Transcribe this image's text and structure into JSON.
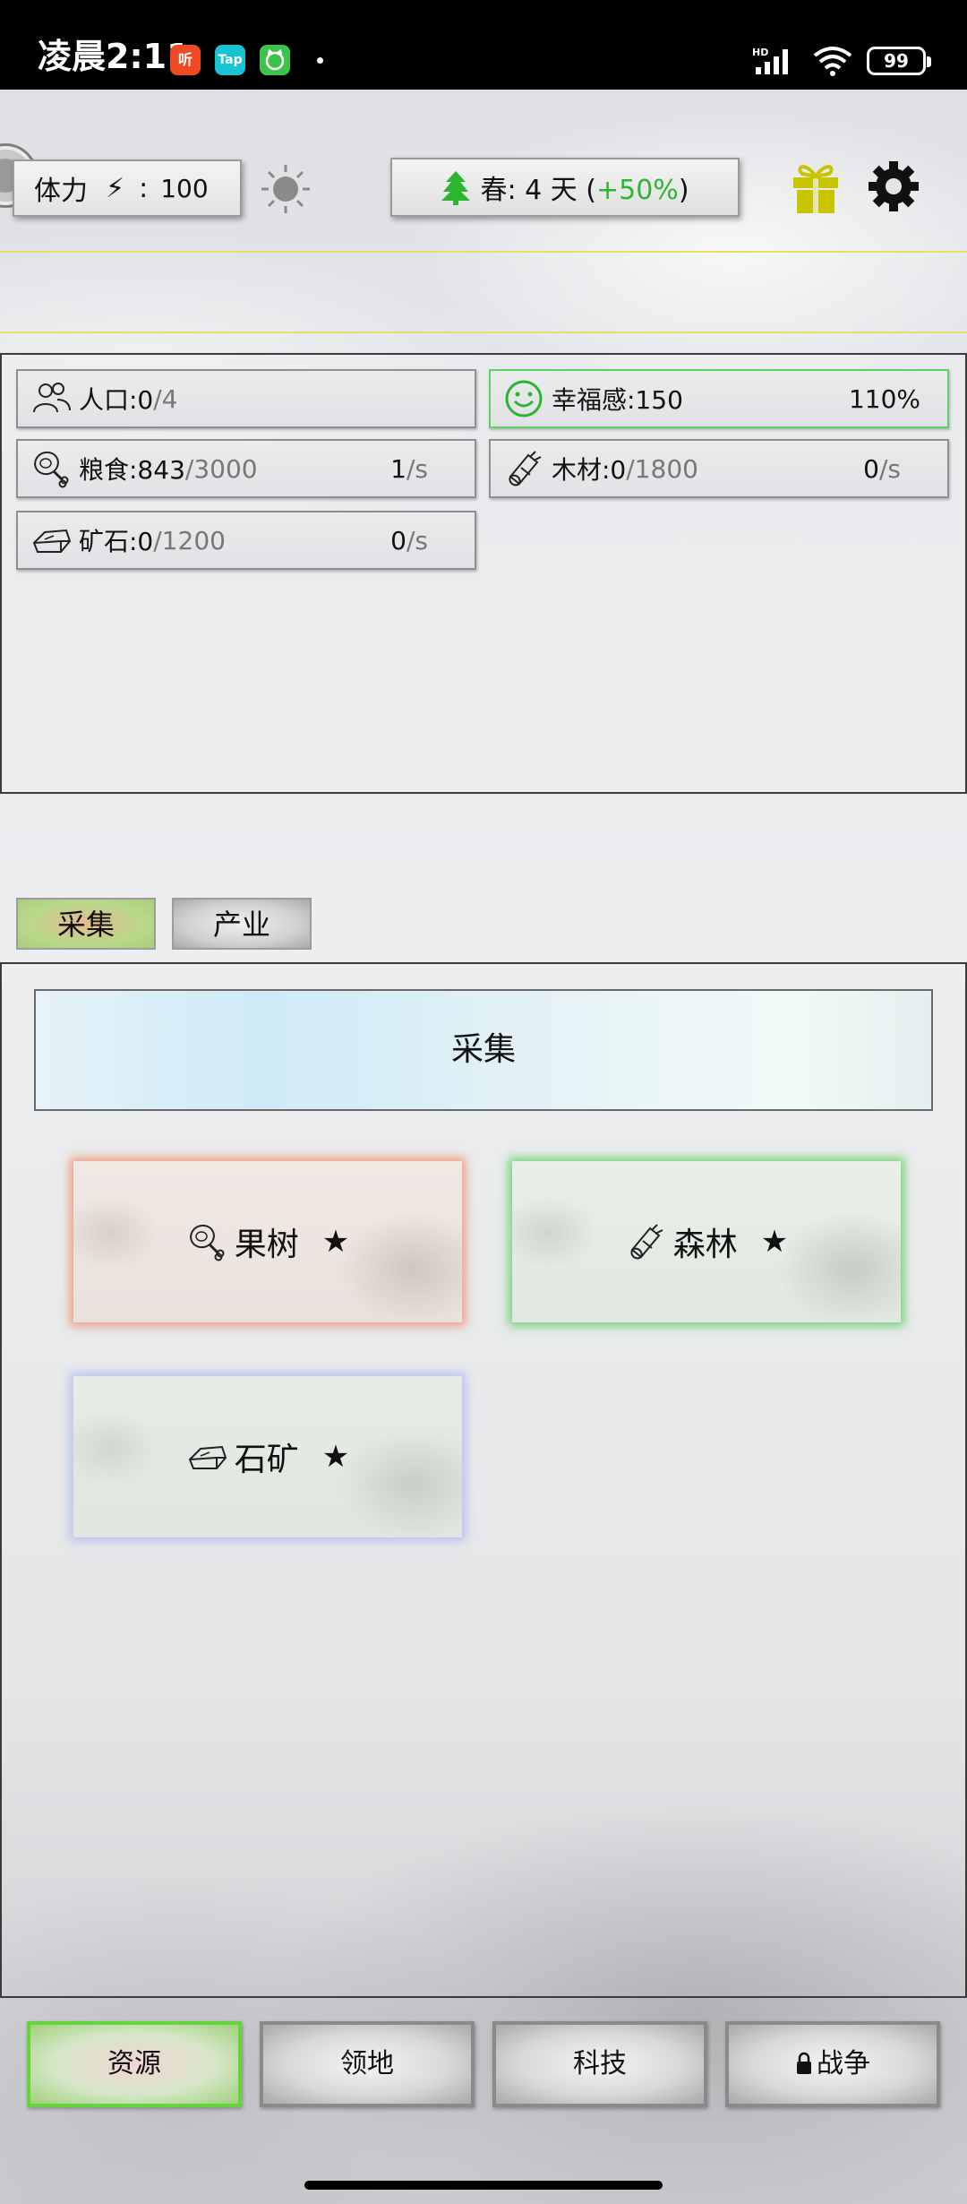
{
  "status_bar": {
    "time": "凌晨2:11",
    "apps": [
      {
        "name": "ting-app-icon",
        "text": "听",
        "color": "#f04a24"
      },
      {
        "name": "taptap-app-icon",
        "text": "Tap",
        "color": "#18c3d4"
      },
      {
        "name": "cat-app-icon",
        "text": "",
        "color": "#3ec34a"
      }
    ],
    "network": "HD",
    "battery": "99"
  },
  "top_bar": {
    "stamina_label": "体力",
    "stamina_colon": ":",
    "stamina_value": "100",
    "season_label": "春: 4 天 (",
    "season_bonus": "+50%",
    "season_close": ")"
  },
  "resources": {
    "population": {
      "label": "人口:0",
      "cap": "/4"
    },
    "happiness": {
      "label": "幸福感:150",
      "percent": "110%"
    },
    "food": {
      "label": "粮食:843",
      "cap": "/3000",
      "rate": "1",
      "unit": "/s"
    },
    "wood": {
      "label": "木材:0",
      "cap": "/1800",
      "rate": "0",
      "unit": "/s"
    },
    "ore": {
      "label": "矿石:0",
      "cap": "/1200",
      "rate": "0",
      "unit": "/s"
    }
  },
  "tabs": {
    "gather": "采集",
    "industry": "产业"
  },
  "section_title": "采集",
  "gather_cards": [
    {
      "label": "果树",
      "star": "★",
      "glow": "#f0825a"
    },
    {
      "label": "森林",
      "star": "★",
      "glow": "#50c850"
    },
    {
      "label": "石矿",
      "star": "★",
      "glow": "#aab4f0"
    }
  ],
  "bottom_nav": {
    "resources": "资源",
    "territory": "领地",
    "tech": "科技",
    "war": "战争",
    "war_locked": true
  },
  "colors": {
    "bonus_green": "#2bb531",
    "gift_yellow": "#c8c400",
    "active_green": "#63d53a"
  }
}
